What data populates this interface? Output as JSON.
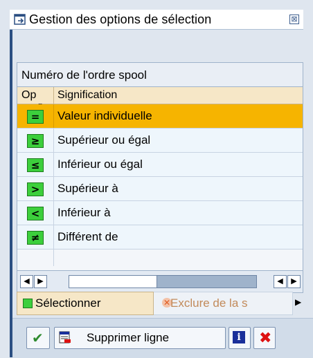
{
  "window": {
    "title": "Gestion des options de sélection",
    "close_glyph": "⊠"
  },
  "panel": {
    "title": "Numéro de l'ordre spool",
    "columns": {
      "option": "Op",
      "option_ellipsis": "...",
      "meaning": "Signification"
    },
    "rows": [
      {
        "symbol": "=",
        "label": "Valeur individuelle",
        "selected": true
      },
      {
        "symbol": "≥",
        "label": "Supérieur ou égal",
        "selected": false
      },
      {
        "symbol": "≤",
        "label": "Inférieur ou égal",
        "selected": false
      },
      {
        "symbol": ">",
        "label": "Supérieur à",
        "selected": false
      },
      {
        "symbol": "<",
        "label": "Inférieur à",
        "selected": false
      },
      {
        "symbol": "≠",
        "label": "Différent de",
        "selected": false
      }
    ]
  },
  "scroll": {
    "left_glyph": "◀",
    "right_glyph": "▶"
  },
  "tabs": {
    "select_label": "Sélectionner",
    "exclude_label": "Exclure de la s",
    "more_glyph": "▶"
  },
  "toolbar": {
    "confirm_glyph": "✔",
    "delete_label": "Supprimer ligne",
    "info_glyph": "i",
    "cancel_glyph": "✖"
  },
  "colors": {
    "selected_row": "#f6b400",
    "option_icon": "#3ccf3c",
    "header_bg": "#f6e7c7",
    "accent": "#2b4f82"
  },
  "icons": [
    "window-edit-icon",
    "close-icon",
    "equals-icon",
    "greater-equal-icon",
    "less-equal-icon",
    "greater-icon",
    "less-icon",
    "not-equal-icon",
    "checkmark-icon",
    "delete-row-icon",
    "info-icon",
    "cancel-icon"
  ]
}
